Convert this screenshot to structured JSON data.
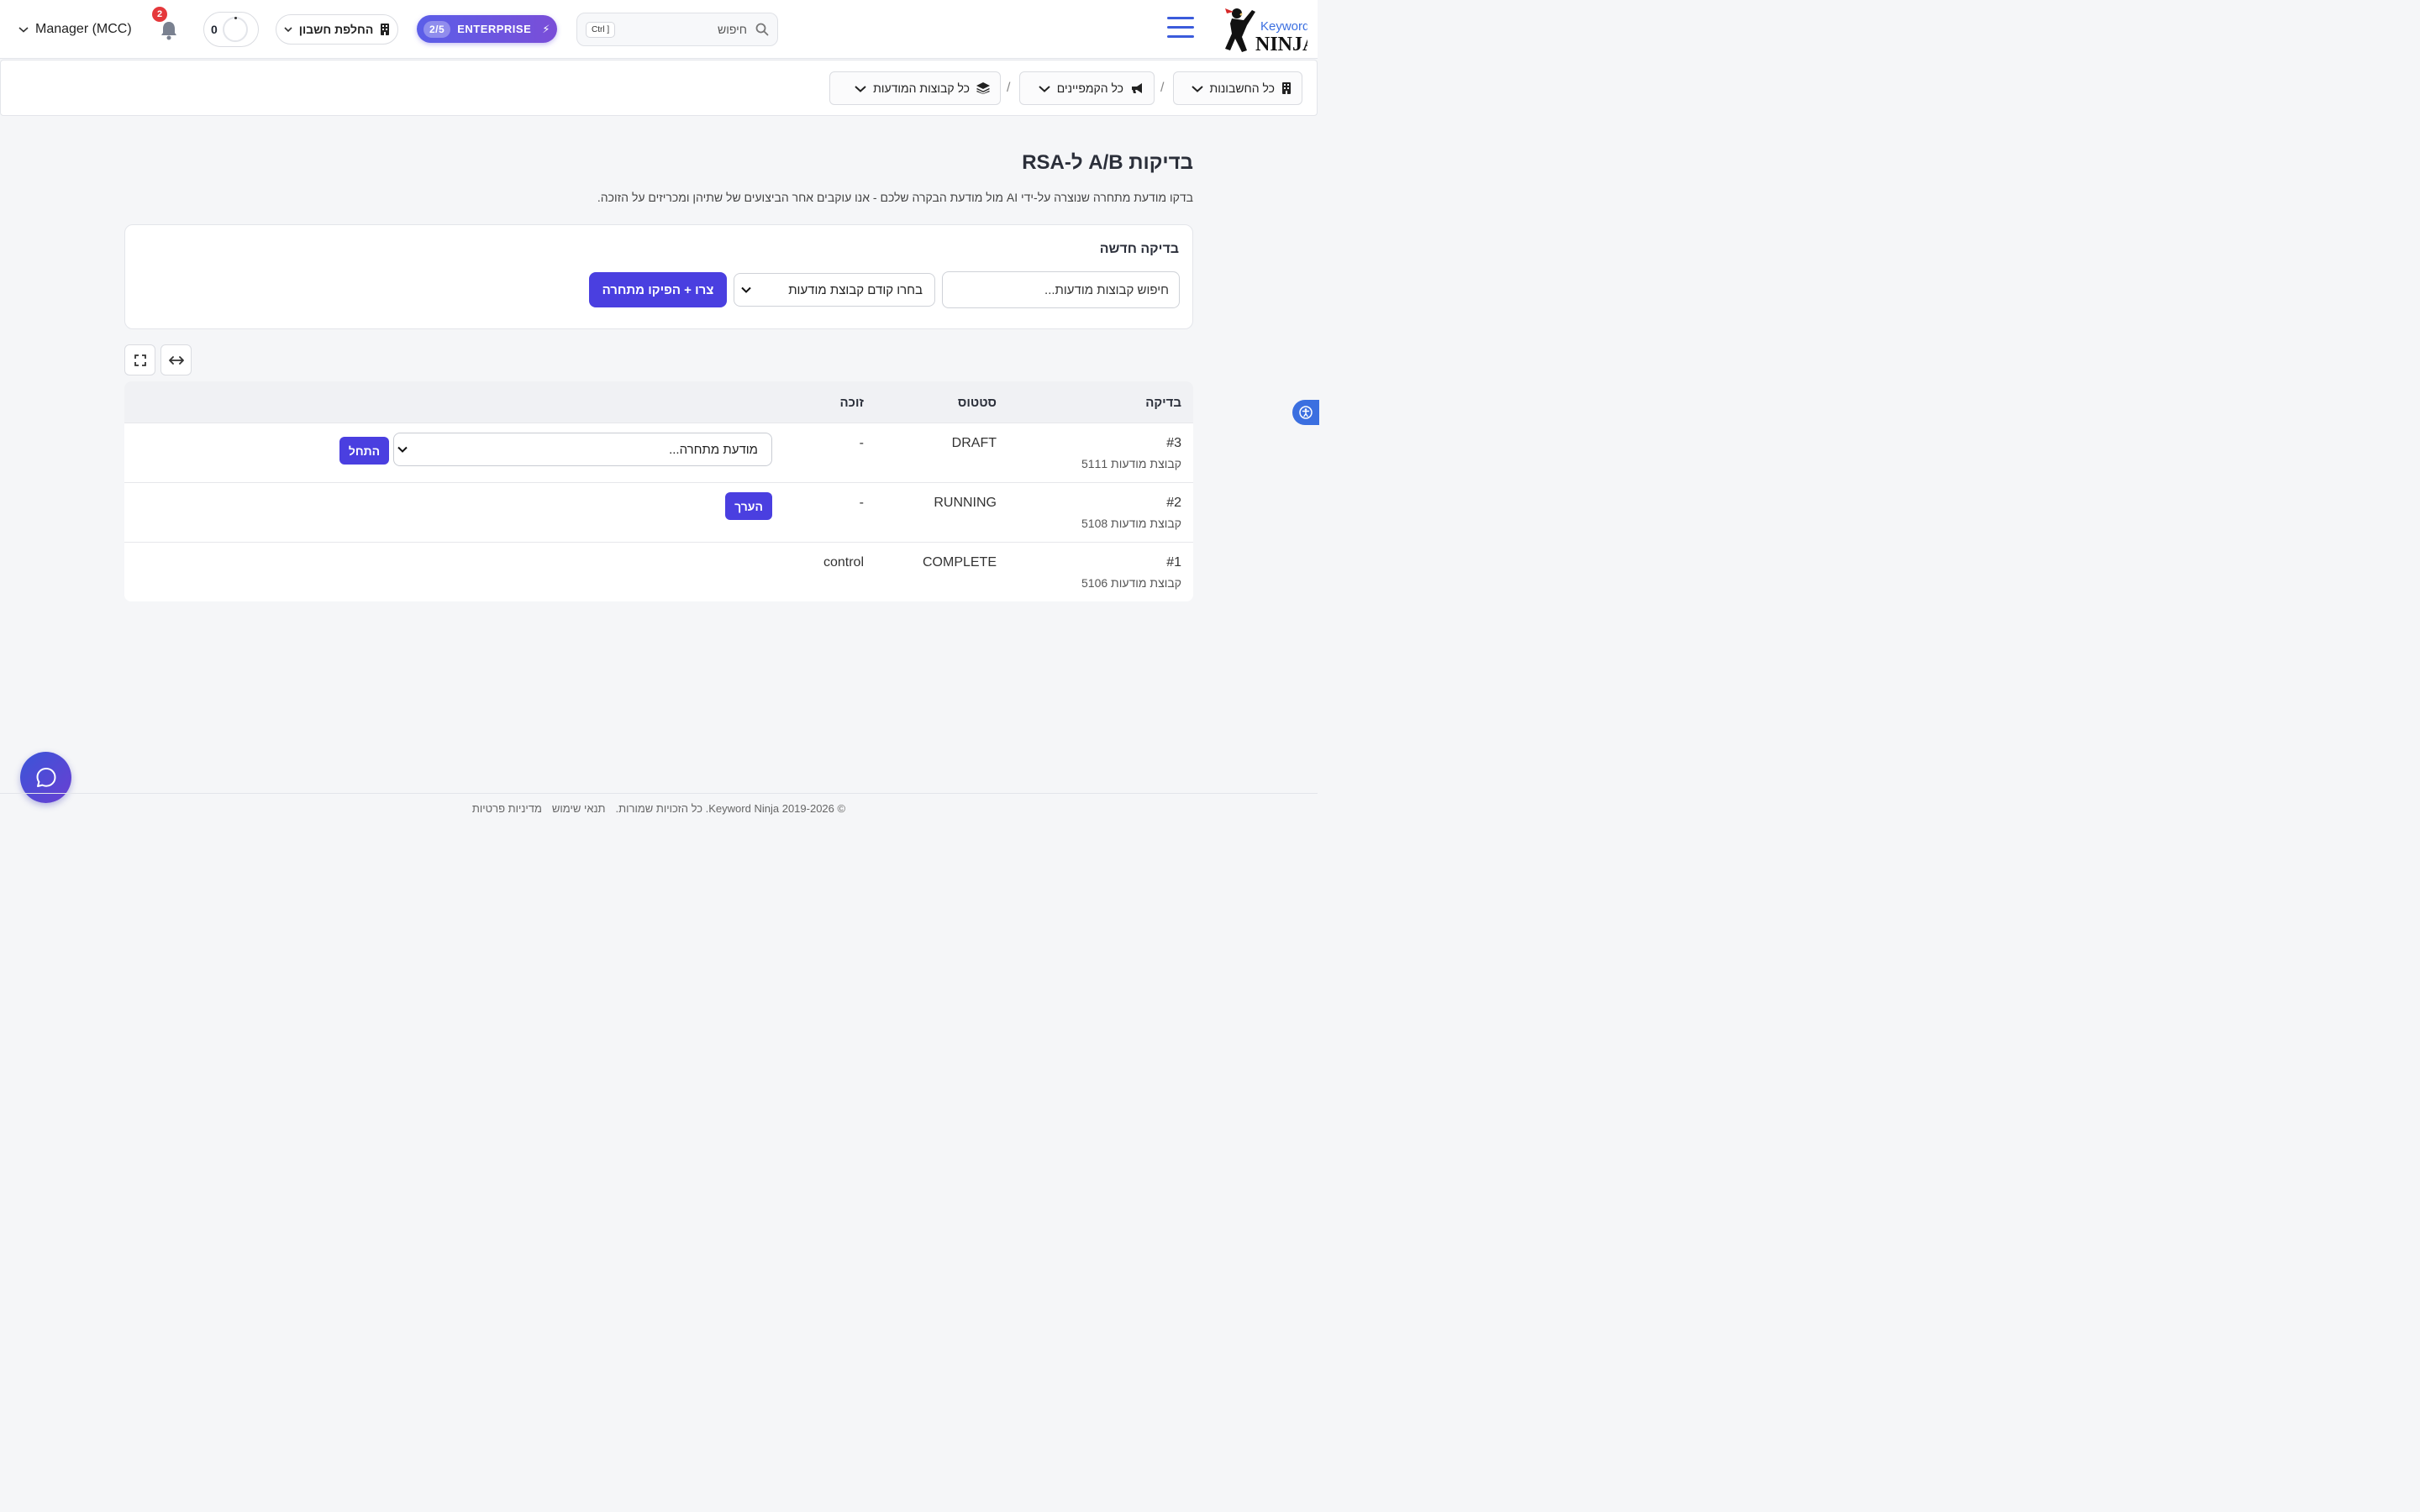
{
  "header": {
    "logo_text": "Keyword NINJA",
    "search": {
      "placeholder": "חיפוש",
      "shortcut": "Ctrl ]"
    },
    "plan": {
      "count": "2/5",
      "label": "ENTERPRISE"
    },
    "switch_account_label": "החלפת חשבון",
    "progress_value": "0",
    "notifications_count": "2",
    "manager_label": "Manager (MCC)"
  },
  "breadcrumb": {
    "accounts": "כל החשבונות",
    "campaigns": "כל הקמפיינים",
    "adgroups": "כל קבוצות המודעות",
    "separator": "/"
  },
  "page": {
    "title": " בדיקות A/B ל-RSA",
    "subtitle": "בדקו מודעת מתחרה שנוצרה על-ידי AI מול מודעת הבקרה שלכם - אנו עוקבים אחר הביצועים של שתיהן ומכריזים על הזוכה."
  },
  "new_test": {
    "title": "בדיקה חדשה",
    "search_placeholder": "חיפוש קבוצות מודעות...",
    "select_value": "בחרו קודם קבוצת מודעות",
    "generate_button": "צרו + הפיקו מתחרה"
  },
  "table": {
    "headers": {
      "test": "בדיקה",
      "status": "סטטוס",
      "winner": "זוכה"
    },
    "rows": [
      {
        "id": "#3",
        "adgroup": "קבוצת מודעות 5111",
        "status": "DRAFT",
        "winner": "-",
        "variant_select": "מודעת מתחרה...",
        "action": "התחל"
      },
      {
        "id": "#2",
        "adgroup": "קבוצת מודעות 5108",
        "status": "RUNNING",
        "winner": "-",
        "action": "הערך"
      },
      {
        "id": "#1",
        "adgroup": "קבוצת מודעות 5106",
        "status": "COMPLETE",
        "winner": "control"
      }
    ]
  },
  "footer": {
    "copyright": "© 2019-2026 Keyword Ninja. כל הזכויות שמורות.",
    "terms": "תנאי שימוש",
    "privacy": "מדיניות פרטיות"
  },
  "colors": {
    "accent": "#4a3fe0",
    "brand_blue": "#3b5bdb",
    "badge_red": "#e5383b"
  }
}
